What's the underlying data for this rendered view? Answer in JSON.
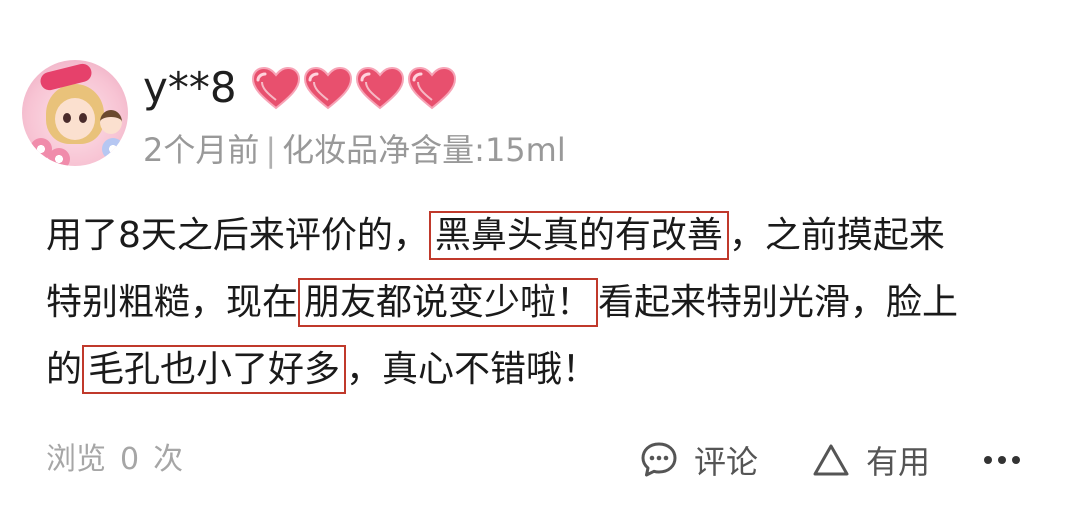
{
  "user": {
    "name": "y**8",
    "heart_count": 4,
    "heart_color": "#e8506e"
  },
  "meta": {
    "time": "2个月前",
    "separator": "|",
    "spec": "化妆品净含量:15ml"
  },
  "review": {
    "line1_a": "用了8天之后来评价的，",
    "line1_hl": "黑鼻头真的有改善",
    "line1_b": "，之前摸起来",
    "line2_a": "特别粗糙，现在",
    "line2_hl": "朋友都说变少啦！",
    "line2_b": "看起来特别光滑，脸上",
    "line3_a": "的",
    "line3_hl": "毛孔也小了好多",
    "line3_b": "，真心不错哦！",
    "highlight_color": "#c0392b"
  },
  "footer": {
    "views_label": "浏览",
    "views_count": "0",
    "views_unit": "次",
    "comment_label": "评论",
    "comment_icon": "chat-bubble-icon",
    "useful_label": "有用",
    "useful_icon": "triangle-up-icon",
    "more_icon": "more-dots-icon"
  }
}
